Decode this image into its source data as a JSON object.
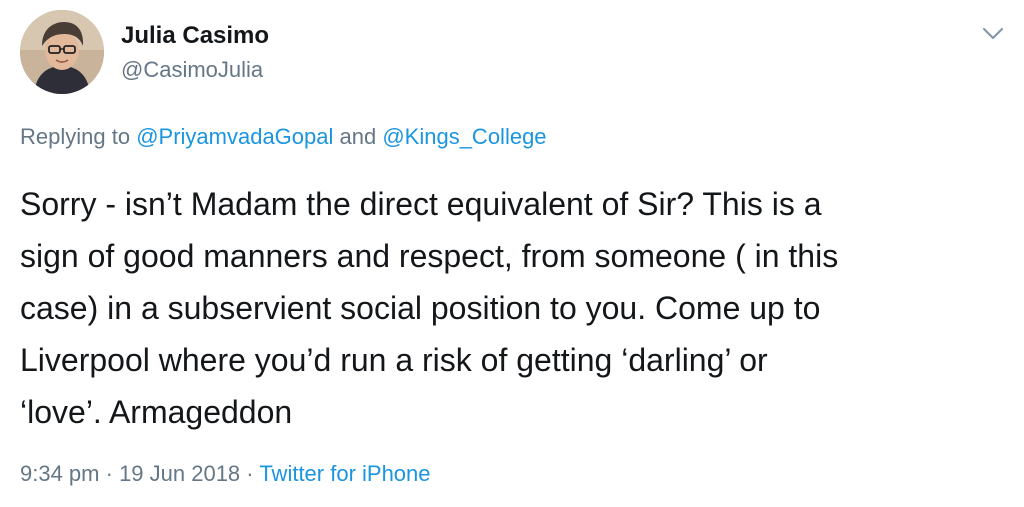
{
  "author": {
    "display_name": "Julia Casimo",
    "handle": "@CasimoJulia"
  },
  "reply": {
    "prefix": "Replying to ",
    "mention_1": "@PriyamvadaGopal",
    "conjunction": " and ",
    "mention_2": "@Kings_College"
  },
  "tweet": {
    "text": "Sorry - isn’t Madam the direct equivalent of Sir? This is a\nsign of good manners and respect, from someone ( in this\ncase) in a subservient social position to you. Come up to\nLiverpool where you’d run a risk of getting ‘darling’ or\n‘love’. Armageddon"
  },
  "meta": {
    "time": "9:34 pm",
    "separator": " · ",
    "date": "19 Jun 2018",
    "source": "Twitter for iPhone"
  },
  "icons": {
    "avatar": "avatar-photo",
    "menu": "chevron-down-icon"
  },
  "colors": {
    "link": "#1b95e0",
    "secondary_text": "#657786",
    "primary_text": "#14171a"
  }
}
